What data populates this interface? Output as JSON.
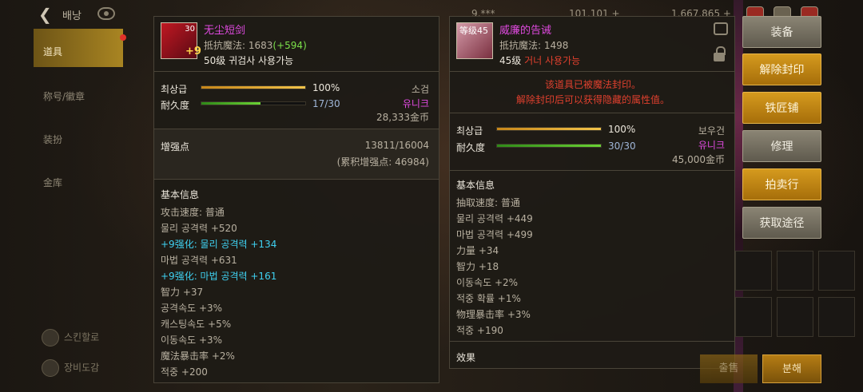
{
  "topbar": {
    "back_label": "배낭",
    "res1": "9,***",
    "res2": "101,101 +",
    "res3": "1,667,865 +"
  },
  "leftnav": {
    "items": [
      "道具",
      "称号/徽章",
      "装扮",
      "金库"
    ],
    "bottom": [
      "스킨할로",
      "장비도감"
    ]
  },
  "left_item": {
    "name": "无尘短剑",
    "icon_level": "30",
    "icon_enhance": "+9",
    "magic_resist_label": "抵抗魔法:",
    "magic_resist_value": "1683",
    "magic_resist_bonus": "(+594)",
    "requirement": "50级 귀검사 사용가능",
    "grade_label": "최상급",
    "grade_pct": "100%",
    "grade_fill": 1.0,
    "durability_label": "耐久度",
    "durability_value": "17/30",
    "durability_fill": 0.567,
    "type": "소검",
    "rarity": "유니크",
    "price": "28,333金币",
    "enhance_label": "增强点",
    "enhance_value": "13811/16004",
    "enhance_total": "(累积增强点:  46984)",
    "basic_info": "基本信息",
    "stats": [
      {
        "text": "攻击速度:  普通",
        "color": "gray"
      },
      {
        "text": "물리 공격력 +520",
        "color": "gray"
      },
      {
        "text": "+9强化:  물리 공격력 +134",
        "color": "cyan"
      },
      {
        "text": "마법 공격력 +631",
        "color": "gray"
      },
      {
        "text": "+9强化:  마법 공격력 +161",
        "color": "cyan"
      },
      {
        "text": "智力 +37",
        "color": "gray"
      },
      {
        "text": "공격속도 +3%",
        "color": "gray"
      },
      {
        "text": "캐스팅속도 +5%",
        "color": "gray"
      },
      {
        "text": "이동속도 +3%",
        "color": "gray"
      },
      {
        "text": "魔法暴击率 +2%",
        "color": "gray"
      },
      {
        "text": "적중 +200",
        "color": "gray"
      }
    ]
  },
  "right_item": {
    "name": "威廉的告诫",
    "icon_level_label": "等级45",
    "magic_resist_label": "抵抗魔法:",
    "magic_resist_value": "1498",
    "requirement_level": "45级",
    "requirement_class": "거너 사용가능",
    "seal_msg1": "该道具已被魔法封印。",
    "seal_msg2": "解除封印后可以获得隐藏的属性值。",
    "grade_label": "최상급",
    "grade_pct": "100%",
    "grade_fill": 1.0,
    "durability_label": "耐久度",
    "durability_value": "30/30",
    "durability_fill": 1.0,
    "type": "보우건",
    "rarity": "유니크",
    "price": "45,000金币",
    "basic_info": "基本信息",
    "stats": [
      "抽取速度:  普通",
      "물리 공격력 +449",
      "마법 공격력 +499",
      "力量 +34",
      "智力 +18",
      "이동속도 +2%",
      "적중 확률 +1%",
      "物理暴击率 +3%",
      "적중 +190"
    ],
    "effect_label": "效果"
  },
  "actions": {
    "equip": "装备",
    "unseal": "解除封印",
    "smith": "铁匠铺",
    "repair": "修理",
    "auction": "拍卖行",
    "obtain": "获取途径"
  },
  "bottom": {
    "sell": "출售",
    "decompose": "분해"
  }
}
